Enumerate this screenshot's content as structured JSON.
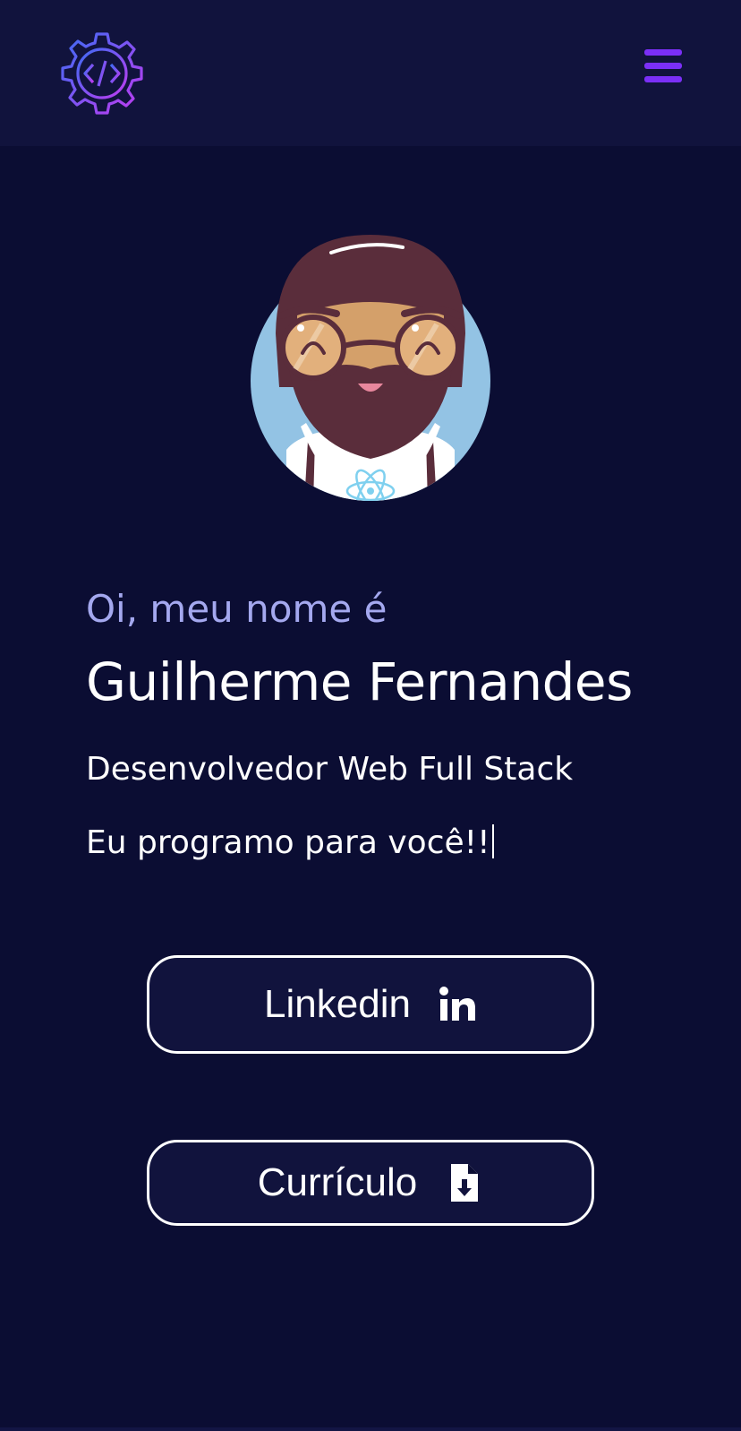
{
  "header": {
    "logo_icon": "gear-code-icon",
    "menu_icon": "hamburger-menu-icon",
    "accent_color": "#7b2ff7"
  },
  "hero": {
    "avatar_icon": "bearded-developer-avatar",
    "greeting": "Oi, meu nome é",
    "name": "Guilherme Fernandes",
    "role": "Desenvolvedor Web Full Stack",
    "tagline": "Eu programo para você!!"
  },
  "buttons": {
    "linkedin_label": "Linkedin",
    "linkedin_icon": "linkedin-icon",
    "cv_label": "Currículo",
    "cv_icon": "file-download-icon"
  },
  "colors": {
    "background": "#0b0d33",
    "header_background": "#11133d",
    "greeting": "#a4a8ef",
    "text": "#ffffff"
  }
}
